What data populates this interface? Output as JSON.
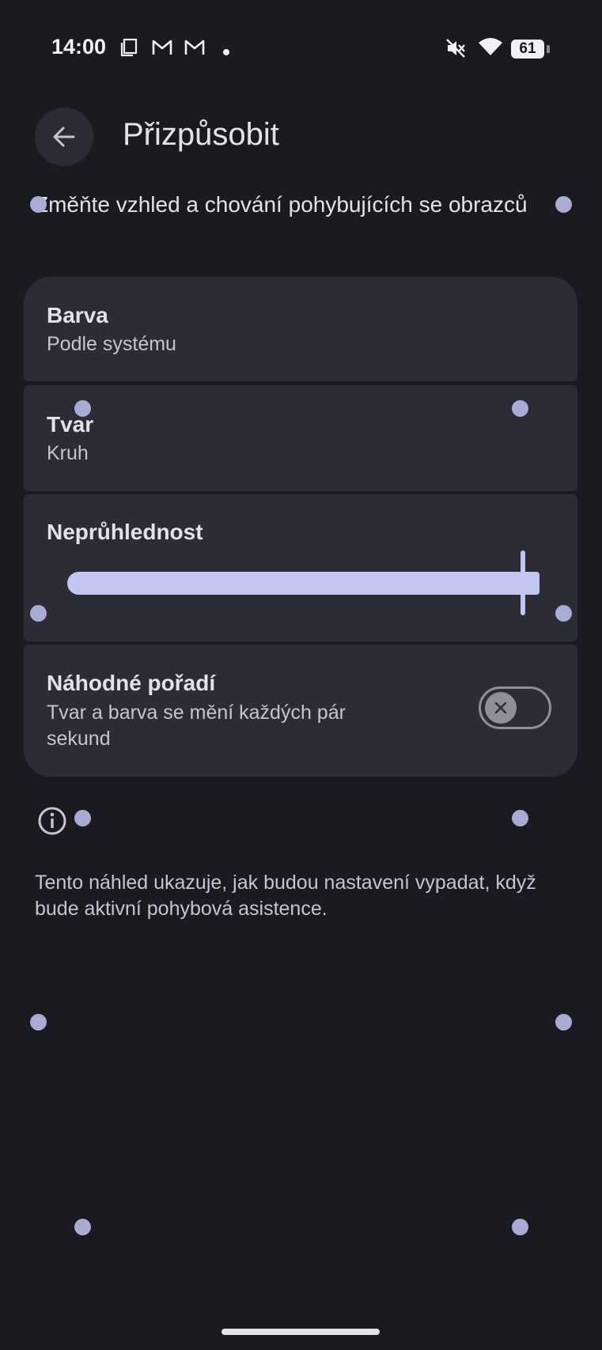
{
  "status_bar": {
    "time": "14:00",
    "battery": "61",
    "icons": [
      "screenshot-icon",
      "gmail-icon",
      "gmail-icon",
      "notification-dot-icon",
      "mute-icon",
      "wifi-icon",
      "battery-icon"
    ]
  },
  "header": {
    "title": "Přizpůsobit"
  },
  "description": "Změňte vzhled a chování pohybujících se obrazců",
  "settings": {
    "color": {
      "title": "Barva",
      "value": "Podle systému"
    },
    "shape": {
      "title": "Tvar",
      "value": "Kruh"
    },
    "opacity": {
      "title": "Neprůhlednost",
      "level": 1.0
    },
    "random_order": {
      "title": "Náhodné pořadí",
      "subtitle": "Tvar a barva se mění každých pár sekund",
      "enabled": false
    }
  },
  "footer": {
    "note": "Tento náhled ukazuje, jak budou nastavení vypadat, když bude aktivní pohybová asistence."
  },
  "colors": {
    "background": "#1a1b20",
    "card": "#2b2c36",
    "accent": "#c3c6f0",
    "dot": "#a9abd4"
  }
}
